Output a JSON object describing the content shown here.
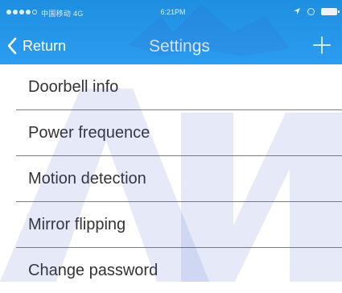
{
  "status_bar": {
    "carrier": "中国移动 4G",
    "time": "6:21PM"
  },
  "nav": {
    "back_label": "Return",
    "title": "Settings",
    "add_icon": "plus-icon"
  },
  "settings": {
    "items": [
      {
        "label": "Doorbell info"
      },
      {
        "label": "Power frequence"
      },
      {
        "label": "Motion detection"
      },
      {
        "label": "Mirror flipping"
      },
      {
        "label": "Change password"
      }
    ]
  },
  "colors": {
    "header_blue": "#2b9cf0",
    "watermark_blue": "#3f5bc8",
    "divider": "#7d7d7d",
    "text": "#333333"
  }
}
